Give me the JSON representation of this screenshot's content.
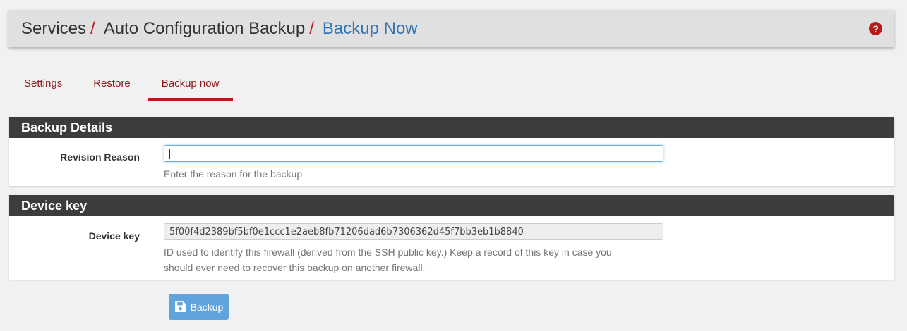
{
  "breadcrumb": {
    "items": [
      "Services",
      "Auto Configuration Backup",
      "Backup Now"
    ],
    "separator": "/"
  },
  "help_icon": "question-circle-icon",
  "tabs": [
    {
      "label": "Settings",
      "active": false
    },
    {
      "label": "Restore",
      "active": false
    },
    {
      "label": "Backup now",
      "active": true
    }
  ],
  "backup_details": {
    "heading": "Backup Details",
    "revision_reason": {
      "label": "Revision Reason",
      "value": "",
      "help": "Enter the reason for the backup"
    }
  },
  "device_key_section": {
    "heading": "Device key",
    "device_key": {
      "label": "Device key",
      "value": "5f00f4d2389bf5bf0e1ccc1e2aeb8fb71206dad6b7306362d45f7bb3eb1b8840",
      "help_line1": "ID used to identify this firewall (derived from the SSH public key.) Keep a record of this key in case you",
      "help_line2": "should ever need to recover this backup on another firewall."
    }
  },
  "actions": {
    "backup_label": "Backup",
    "backup_icon": "save-icon"
  },
  "colors": {
    "accent_red": "#b71c1c",
    "link_blue": "#3476b3",
    "panel_heading": "#3c3c3c",
    "button": "#5aa0dc"
  }
}
